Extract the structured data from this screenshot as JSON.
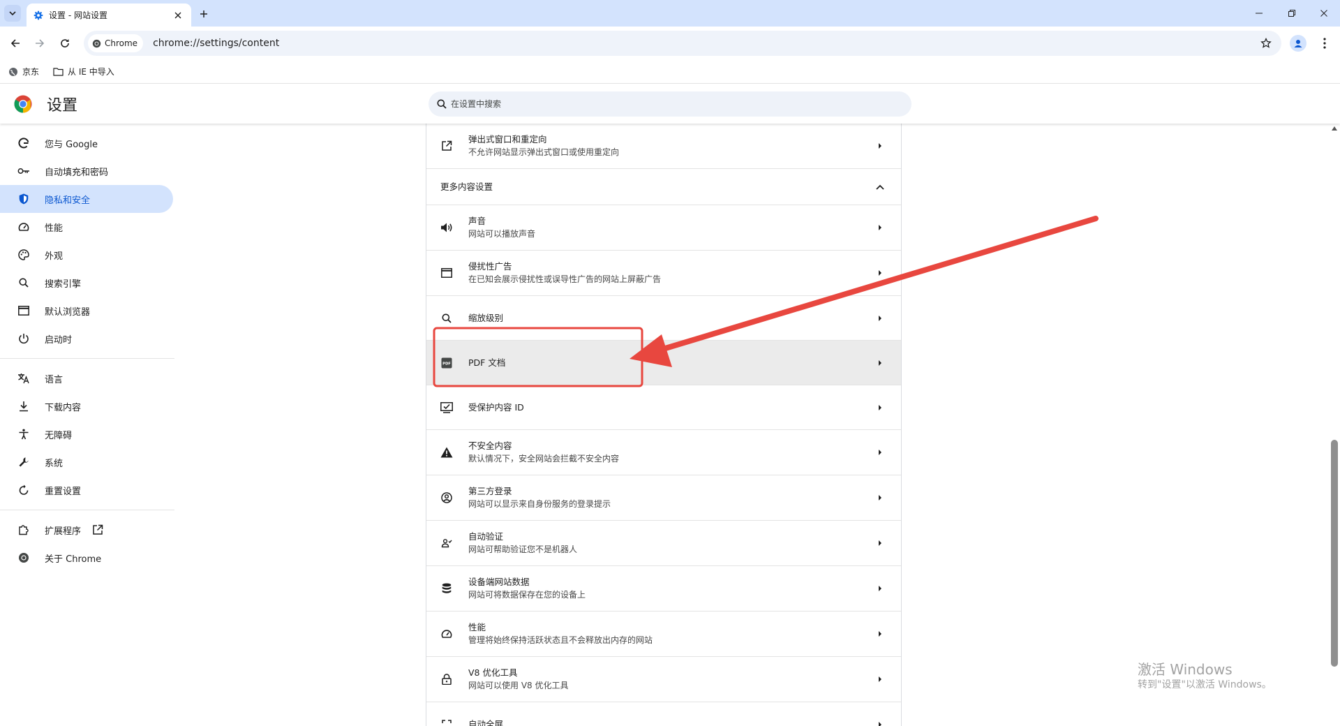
{
  "tab": {
    "title": "设置 - 网站设置",
    "icon": "gear-icon"
  },
  "toolbar": {
    "chip_label": "Chrome",
    "url": "chrome://settings/content"
  },
  "bookmarks": [
    {
      "label": "京东",
      "icon": "globe-icon"
    },
    {
      "label": "从 IE 中导入",
      "icon": "folder-icon"
    }
  ],
  "header": {
    "title": "设置",
    "search_placeholder": "在设置中搜索"
  },
  "sidebar": {
    "items": [
      {
        "label": "您与 Google",
        "icon": "google-icon"
      },
      {
        "label": "自动填充和密码",
        "icon": "key-icon"
      },
      {
        "label": "隐私和安全",
        "icon": "shield-icon",
        "active": true
      },
      {
        "label": "性能",
        "icon": "speedometer-icon"
      },
      {
        "label": "外观",
        "icon": "palette-icon"
      },
      {
        "label": "搜索引擎",
        "icon": "search-icon"
      },
      {
        "label": "默认浏览器",
        "icon": "browser-icon"
      },
      {
        "label": "启动时",
        "icon": "power-icon"
      },
      {
        "label": "语言",
        "icon": "translate-icon"
      },
      {
        "label": "下载内容",
        "icon": "download-icon"
      },
      {
        "label": "无障碍",
        "icon": "accessibility-icon"
      },
      {
        "label": "系统",
        "icon": "wrench-icon"
      },
      {
        "label": "重置设置",
        "icon": "reset-icon"
      },
      {
        "label": "扩展程序",
        "icon": "puzzle-icon"
      },
      {
        "label": "关于 Chrome",
        "icon": "chrome-icon"
      }
    ]
  },
  "content": {
    "popups": {
      "title": "弹出式窗口和重定向",
      "desc": "不允许网站显示弹出式窗口或使用重定向"
    },
    "more_section": "更多内容设置",
    "rows": [
      {
        "title": "声音",
        "desc": "网站可以播放声音",
        "icon": "speaker-icon"
      },
      {
        "title": "侵扰性广告",
        "desc": "在已知会展示侵扰性或误导性广告的网站上屏蔽广告",
        "icon": "window-icon"
      },
      {
        "title": "缩放级别",
        "desc": "",
        "icon": "zoom-icon"
      },
      {
        "title": "PDF 文档",
        "desc": "",
        "icon": "pdf-icon"
      },
      {
        "title": "受保护内容 ID",
        "desc": "",
        "icon": "checkbox-icon"
      },
      {
        "title": "不安全内容",
        "desc": "默认情况下，安全网站会拦截不安全内容",
        "icon": "warning-icon"
      },
      {
        "title": "第三方登录",
        "desc": "网站可以显示来自身份服务的登录提示",
        "icon": "account-icon"
      },
      {
        "title": "自动验证",
        "desc": "网站可帮助验证您不是机器人",
        "icon": "person-check-icon"
      },
      {
        "title": "设备端网站数据",
        "desc": "网站可将数据保存在您的设备上",
        "icon": "database-icon"
      },
      {
        "title": "性能",
        "desc": "管理将始终保持活跃状态且不会释放出内存的网站",
        "icon": "speedometer-icon"
      },
      {
        "title": "V8 优化工具",
        "desc": "网站可以使用 V8 优化工具",
        "icon": "lock-icon"
      },
      {
        "title": "自动全屏",
        "desc": "",
        "icon": "fullscreen-icon"
      }
    ]
  },
  "watermark": {
    "line1": "激活 Windows",
    "line2": "转到\"设置\"以激活 Windows。"
  },
  "colors": {
    "tab_strip": "#d3e3fd",
    "active_sidebar": "#d3e3fd",
    "active_text": "#0b57d0",
    "annotation_red": "#e8473f",
    "highlight_row": "#ebebeb"
  }
}
